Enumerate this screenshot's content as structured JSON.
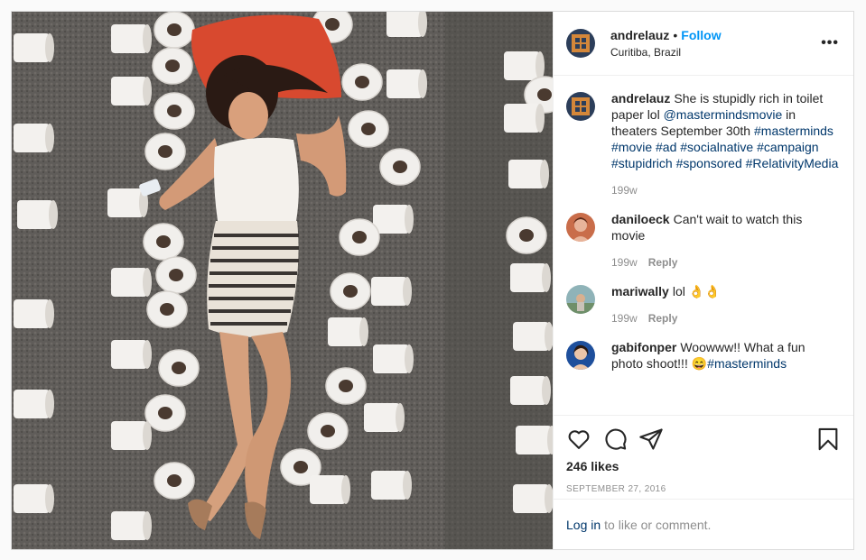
{
  "post": {
    "author": "andrelauz",
    "follow_label": "Follow",
    "location": "Curitiba, Brazil",
    "more_icon": "more-horizontal-icon"
  },
  "caption": {
    "author": "andrelauz",
    "text_parts": [
      "She is stupidly rich in toilet paper lol ",
      "@mastermindsmovie",
      " in theaters September 30th ",
      "#masterminds #movie #ad #socialnative #campaign #stupidrich #sponsored #RelativityMedia"
    ],
    "age": "199w"
  },
  "comments": [
    {
      "author": "daniloeck",
      "text": "Can't wait to watch this movie",
      "age": "199w",
      "reply": "Reply"
    },
    {
      "author": "mariwally",
      "text": "lol 👌👌",
      "age": "199w",
      "reply": "Reply"
    },
    {
      "author": "gabifonper",
      "text": "Woowww!! What a fun photo shoot!!! 😄",
      "tag": "#masterminds"
    }
  ],
  "actions": {
    "like_icon": "heart-icon",
    "comment_icon": "comment-icon",
    "share_icon": "share-icon",
    "save_icon": "bookmark-icon",
    "likes": "246 likes",
    "date": "SEPTEMBER 27, 2016"
  },
  "login": {
    "link": "Log in",
    "text": "to like or comment."
  }
}
